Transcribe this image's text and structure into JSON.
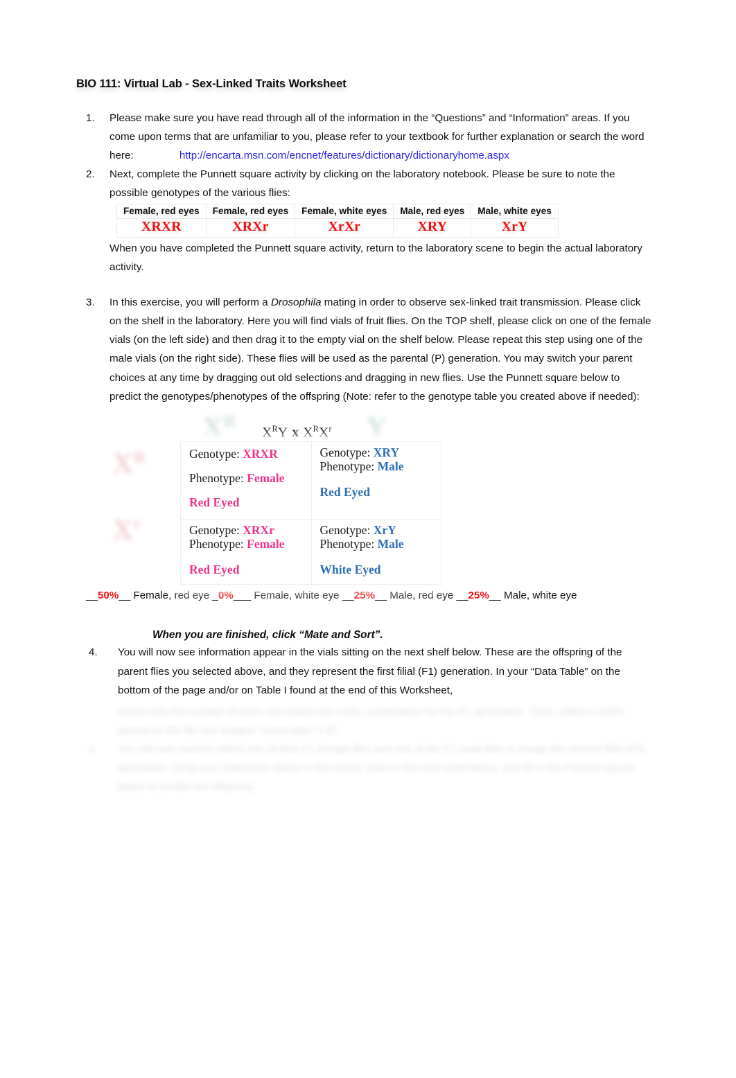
{
  "document": {
    "title": "BIO 111: Virtual Lab - Sex-Linked Traits Worksheet"
  },
  "items": {
    "one": {
      "number": "1.",
      "text": "Please make sure you have read through all of the information in the “Questions” and “Information” areas.  If you come upon terms that are unfamiliar to you, please refer to your textbook for further explanation or search the word here:",
      "link": "http://encarta.msn.com/encnet/features/dictionary/dictionaryhome.aspx"
    },
    "two": {
      "number": "2.",
      "text": "Next, complete the Punnett square activity by clicking on the laboratory notebook.  Please be sure to note the possible genotypes of the various flies:",
      "after_table": "When you have completed the Punnett square activity, return to the laboratory scene to begin the actual laboratory activity."
    },
    "three": {
      "number": "3.",
      "text_part1": "In this exercise, you will perform a ",
      "italic_word": "Drosophila",
      "text_part2": " mating in order to observe sex-linked trait transmission.  Please click on the shelf in the laboratory. Here you will find vials of fruit flies.   On the TOP shelf, please click on one of the female vials (on the left side) and then drag it to the empty vial on the shelf below.  Please repeat this step using one of the male vials (on the right side).  These flies will be used as the parental (P) generation. You may switch your parent choices at any time by dragging out old selections and dragging in new flies. Use the Punnett square below to predict the genotypes/phenotypes of the offspring (Note:  refer to the genotype table you created above if needed):"
    },
    "four": {
      "number": "4.",
      "text": "You will now see information appear in the vials sitting on the next shelf below.  These are the offspring of the parent flies you selected above, and they represent the first filial (F1) generation.  In your “Data Table” on the bottom of the page and/or on Table I found at the end of this Worksheet,"
    }
  },
  "genotype_table": {
    "headers": [
      "Female, red eyes",
      "Female, red eyes",
      "Female, white eyes",
      "Male, red eyes",
      "Male, white eyes"
    ],
    "values": [
      "XRXR",
      "XRXr",
      "XrXr",
      "XRY",
      "XrY"
    ],
    "value_color": "#ee1111"
  },
  "punnett": {
    "cross": {
      "left_base": "X",
      "left_sup": "R",
      "left_second": "Y",
      "operator": "x",
      "right_base1": "X",
      "right_sup1": "R",
      "right_base2": "X",
      "right_sup2": "r"
    },
    "ghost_row_labels": [
      {
        "base": "X",
        "sup": "R"
      },
      {
        "base": "X",
        "sup": "r"
      }
    ],
    "ghost_col_labels": [
      {
        "base": "X",
        "sup": "R"
      },
      {
        "base": "Y",
        "sup": ""
      }
    ],
    "labels": {
      "genotype": "Genotype:",
      "phenotype": "Phenotype:"
    },
    "cells": [
      {
        "genotype": "XRXR",
        "phenotype": "Female",
        "eye": "Red Eyed",
        "color": "#f0338e"
      },
      {
        "genotype": "XRY",
        "phenotype": "Male",
        "eye": "Red Eyed",
        "color": "#2f6eb5"
      },
      {
        "genotype": "XRXr",
        "phenotype": "Female",
        "eye": "Red Eyed",
        "color": "#f0338e"
      },
      {
        "genotype": "XrY",
        "phenotype": "Male",
        "eye": "White Eyed",
        "color": "#2f6eb5"
      }
    ]
  },
  "percent_line": {
    "entries": [
      {
        "blank_before": "__",
        "value": "50%",
        "blank_after": "__",
        "label": " Female, red eye "
      },
      {
        "blank_before": " _",
        "value": "0%",
        "blank_after": "___",
        "label": " Female, white eye   "
      },
      {
        "blank_before": "__",
        "value": "25%",
        "blank_after": "__",
        "label": " Male, red eye "
      },
      {
        "blank_before": " __",
        "value": "25%",
        "blank_after": "__",
        "label": " Male, white eye"
      }
    ],
    "value_color": "#ee1111"
  },
  "mate_line": {
    "text": "When you are finished, click “Mate and Sort”."
  },
  "faded": {
    "line1": "where only the number of each sex and/or eye-color, combination for the F1 generation.  Then, within a 100% placed on the file you student “Generation 1 of”.",
    "number5": "5.",
    "line2": "You will now need to select one of their F1 female flies and one of the F1 male flies to create the second filial (F2) generation.  Drag your selections above to the empty vials on the next shelf below, and fill in the Punnett square below to predict the offspring."
  }
}
